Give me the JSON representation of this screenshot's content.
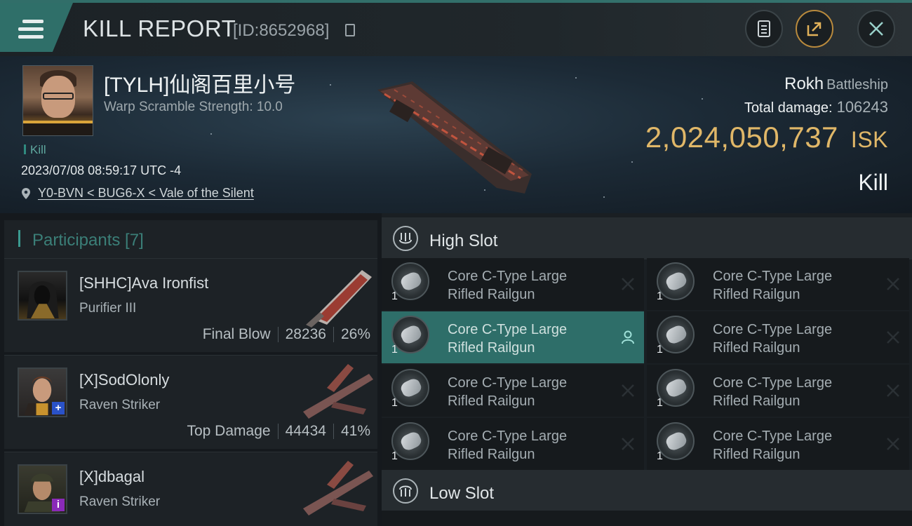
{
  "header": {
    "title": "KILL REPORT",
    "id_text": "[ID:8652968]",
    "buttons": [
      "document-icon",
      "share-icon",
      "close-icon"
    ]
  },
  "victim": {
    "name": "[TYLH]仙阁百里小号",
    "warp_scramble": "Warp Scramble Strength: 10.0",
    "result_tag": "Kill",
    "datetime": "2023/07/08 08:59:17 UTC -4",
    "location": "Y0-BVN < BUG6-X < Vale of the Silent",
    "ship_name": "Rokh",
    "ship_class": "Battleship",
    "total_damage_label": "Total damage:",
    "total_damage": "106243",
    "isk_value": "2,024,050,737",
    "isk_unit": "ISK",
    "kill_label": "Kill"
  },
  "participants": {
    "label": "Participants [7]",
    "rows": [
      {
        "name": "[SHHC]Ava Ironfist",
        "ship": "Purifier III",
        "stat_label": "Final Blow",
        "damage": "28236",
        "percent": "26%"
      },
      {
        "name": "[X]SodOlonly",
        "ship": "Raven Striker",
        "stat_label": "Top Damage",
        "damage": "44434",
        "percent": "41%"
      },
      {
        "name": "[X]dbagal",
        "ship": "Raven Striker"
      }
    ]
  },
  "slots": {
    "high_label": "High Slot",
    "low_label": "Low Slot",
    "modules": [
      {
        "line1": "Core C-Type Large",
        "line2": "Rifled Railgun",
        "qty": "1"
      },
      {
        "line1": "Core C-Type Large",
        "line2": "Rifled Railgun",
        "qty": "1"
      },
      {
        "line1": "Core C-Type Large",
        "line2": "Rifled Railgun",
        "qty": "1"
      },
      {
        "line1": "Core C-Type Large",
        "line2": "Rifled Railgun",
        "qty": "1"
      },
      {
        "line1": "Core C-Type Large",
        "line2": "Rifled Railgun",
        "qty": "1"
      },
      {
        "line1": "Core C-Type Large",
        "line2": "Rifled Railgun",
        "qty": "1"
      },
      {
        "line1": "Core C-Type Large",
        "line2": "Rifled Railgun",
        "qty": "1"
      },
      {
        "line1": "Core C-Type Large",
        "line2": "Rifled Railgun",
        "qty": "1"
      }
    ]
  },
  "colors": {
    "accent": "#2e6e69",
    "isk": "#e0b768",
    "teal_text": "#3b7f78"
  }
}
